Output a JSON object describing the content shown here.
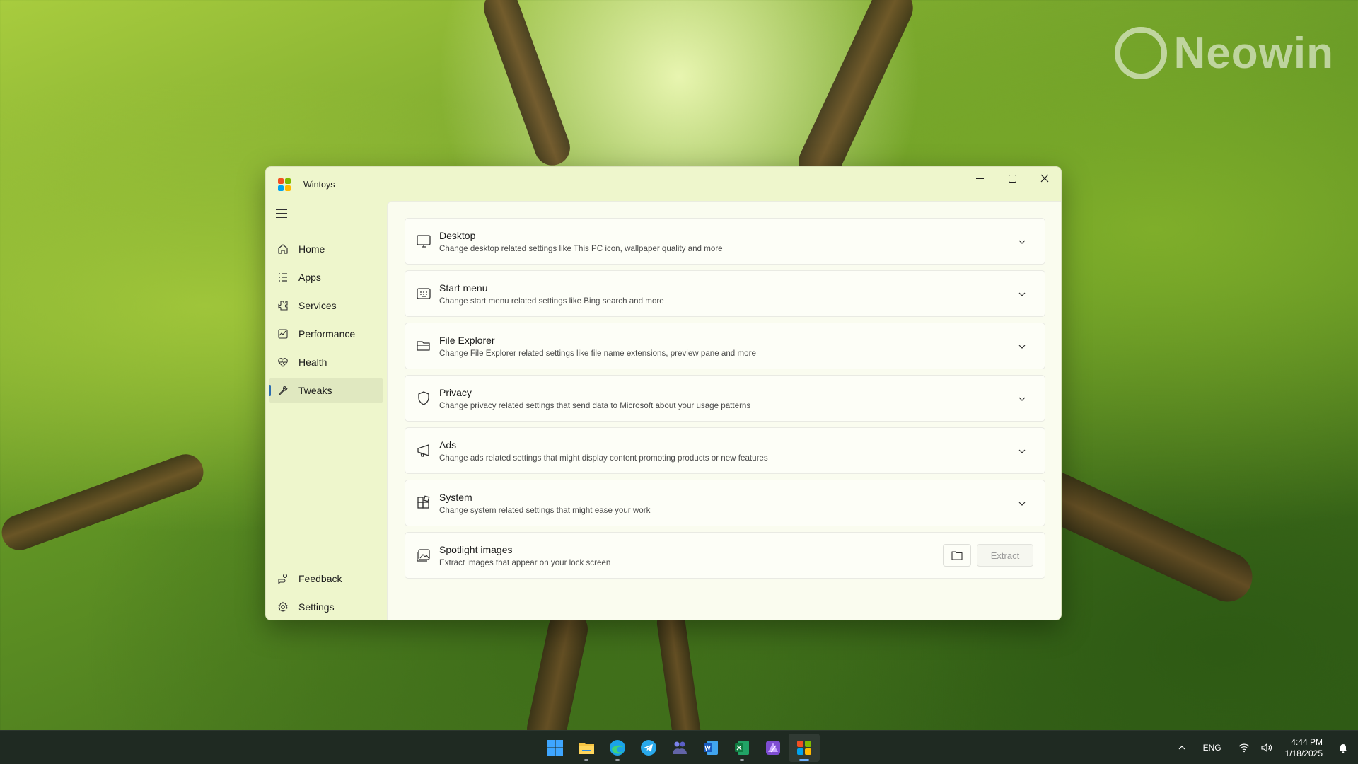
{
  "desktop": {
    "watermark": "Neowin"
  },
  "window": {
    "title": "Wintoys",
    "controls": {
      "minimize": "minimize",
      "maximize": "maximize",
      "close": "close"
    }
  },
  "sidebar": {
    "items": [
      {
        "label": "Home",
        "icon": "home-icon"
      },
      {
        "label": "Apps",
        "icon": "apps-list-icon"
      },
      {
        "label": "Services",
        "icon": "services-icon"
      },
      {
        "label": "Performance",
        "icon": "performance-icon"
      },
      {
        "label": "Health",
        "icon": "health-icon"
      },
      {
        "label": "Tweaks",
        "icon": "wrench-icon",
        "active": true
      }
    ],
    "footer": [
      {
        "label": "Feedback",
        "icon": "feedback-icon"
      },
      {
        "label": "Settings",
        "icon": "gear-icon"
      }
    ]
  },
  "tweaks": [
    {
      "title": "Desktop",
      "desc": "Change desktop related settings like This PC icon, wallpaper quality and more",
      "icon": "monitor-icon"
    },
    {
      "title": "Start menu",
      "desc": "Change start menu related settings like Bing search and more",
      "icon": "start-menu-icon"
    },
    {
      "title": "File Explorer",
      "desc": "Change File Explorer related settings like file name extensions, preview pane and more",
      "icon": "folder-open-icon"
    },
    {
      "title": "Privacy",
      "desc": "Change privacy related settings that send data to Microsoft about your usage patterns",
      "icon": "shield-icon"
    },
    {
      "title": "Ads",
      "desc": "Change ads related settings that might display content promoting products or new features",
      "icon": "megaphone-icon"
    },
    {
      "title": "System",
      "desc": "Change system related settings that might ease your work",
      "icon": "system-icon"
    }
  ],
  "spotlight": {
    "title": "Spotlight images",
    "desc": "Extract images that appear on your lock screen",
    "extract_label": "Extract"
  },
  "taskbar": {
    "apps": [
      "start",
      "file-explorer",
      "edge",
      "telegram",
      "teams",
      "word",
      "excel",
      "affinity",
      "wintoys"
    ],
    "language": "ENG",
    "time": "4:44 PM",
    "date": "1/18/2025"
  },
  "colors": {
    "accent": "#2b6cb0",
    "window_bg": "#eef6cc",
    "content_bg": "#fafcef",
    "taskbar_bg": "#1f2a22"
  }
}
